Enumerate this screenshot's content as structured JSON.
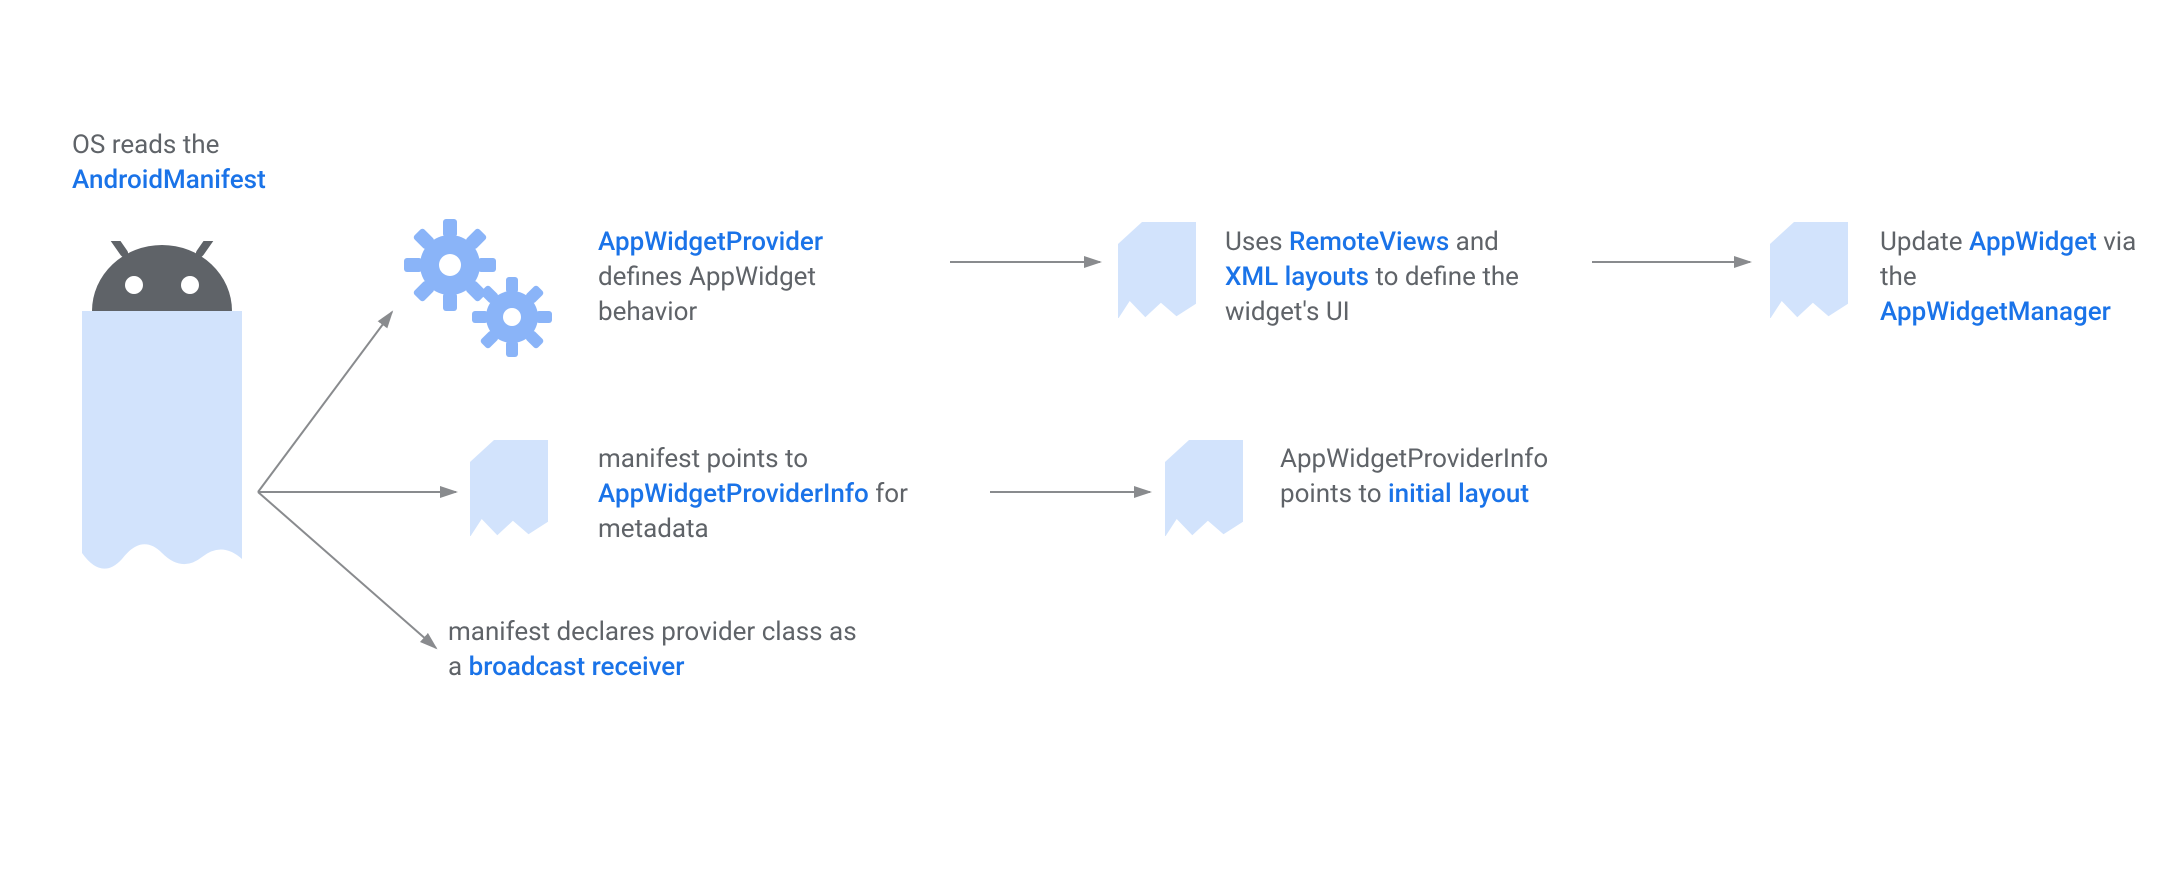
{
  "header": {
    "line1": "OS reads the",
    "line2": "AndroidManifest"
  },
  "nodes": {
    "appwidgetprovider": {
      "title": "AppWidgetProvider",
      "rest_line1": "defines AppWidget",
      "rest_line2": "behavior"
    },
    "remoteviews": {
      "pre": "Uses ",
      "hl1": "RemoteViews",
      "mid": " and ",
      "hl2": "XML layouts",
      "post_line1": " to define the",
      "post_line2": "widget's UI"
    },
    "updatewidget": {
      "pre": "Update ",
      "hl1": "AppWidget",
      "post_line1": " via",
      "line2_pre": "the",
      "hl2": "AppWidgetManager"
    },
    "providerinfo": {
      "line1": "manifest points to",
      "hl": "AppWidgetProviderInfo",
      "post": " for",
      "line3": "metadata"
    },
    "initiallayout": {
      "line1": "AppWidgetProviderInfo",
      "pre": "points to ",
      "hl": "initial layout"
    },
    "broadcast": {
      "line1": "manifest declares provider class as",
      "pre": "a ",
      "hl": "broadcast receiver"
    }
  },
  "colors": {
    "highlight": "#1a73e8",
    "text": "#5f6368",
    "docFill": "#d2e3fc",
    "gearFill": "#8ab4f8",
    "androidFill": "#5f6368"
  }
}
